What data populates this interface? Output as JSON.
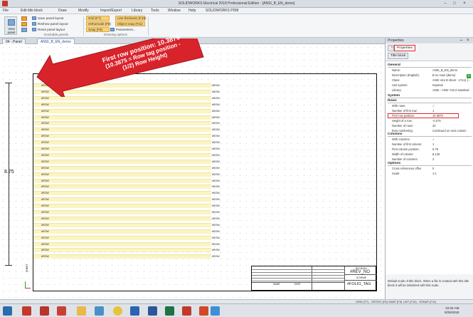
{
  "window": {
    "title": "SOLIDWORKS Electrical 2018 Professional Edition - [ANSI_B_EN_demo]"
  },
  "menu": [
    "File",
    "Edit title block",
    "Draw",
    "Modify",
    "Import/Export",
    "Library",
    "Tools",
    "Window",
    "Help",
    "SOLIDWORKS PDM"
  ],
  "ribbon": {
    "view_label": "View\npanel",
    "panel_buttons": [
      "Save panel layout",
      "Reshow panel layout",
      "Reset panel layout"
    ],
    "panel_group": "Dockable panels",
    "drawing_buttons": [
      "Grid (F7)",
      "Orthomode (F8)",
      "Snap (F9)",
      "Line thickness (F10)",
      "Object snap (F11)",
      "Parameters..."
    ],
    "drawing_group": "Drawing options"
  },
  "tabs": [
    "04 - Panel",
    "ANSI_B_EN_demo"
  ],
  "drawing": {
    "dimension": "8.75",
    "row_tag": "#ROW",
    "side_label": "SHEET",
    "title_block": {
      "rev_no": "#REV_NO",
      "folio_tag": "#FOLIO_TAG",
      "revision": "REVISION",
      "scheme": "SCHEME",
      "names": "NAME",
      "date": "DATE"
    }
  },
  "callout": {
    "line1": "First row position: 10.3875",
    "line2": "(10.3875 = Row tag position -",
    "line3": "(1/2) Row Height)"
  },
  "properties": {
    "header": "Properties",
    "tabs": [
      "Properties",
      "Title block"
    ],
    "sections": {
      "general": "General",
      "system": "System",
      "rows": "Rows",
      "columns": "Columns",
      "options": "Options"
    },
    "general": [
      {
        "k": "Name:",
        "v": "ANSI_B_EN_demo"
      },
      {
        "k": "Description (English):",
        "v": "B no rows (demo)"
      },
      {
        "k": "Class:",
        "v": "ANSI size B sheet - 17x11 (..."
      },
      {
        "k": "Unit system:",
        "v": "Imperial"
      },
      {
        "k": "Library:",
        "v": "ANSI - ANSI Y32.2 standard"
      }
    ],
    "rows": [
      {
        "k": "With rows:",
        "v": "✓"
      },
      {
        "k": "Number of first row:",
        "v": "1"
      },
      {
        "k": "First row position:",
        "v": "10.3875"
      },
      {
        "k": "Height of a row:",
        "v": "-0.275"
      },
      {
        "k": "Number of rows:",
        "v": "32"
      },
      {
        "k": "Row numbering:",
        "v": "Continued on next column"
      }
    ],
    "columns": [
      {
        "k": "With columns:",
        "v": "✓"
      },
      {
        "k": "Number of first column:",
        "v": "1"
      },
      {
        "k": "First column position:",
        "v": "0.75"
      },
      {
        "k": "Width of column:",
        "v": "8.125"
      },
      {
        "k": "Number of columns:",
        "v": "2"
      }
    ],
    "options": [
      {
        "k": "Cross references offse",
        "v": "0"
      },
      {
        "k": "Scale:",
        "v": "1:1"
      }
    ],
    "description": "Default scale of title block. When a file is created with this title block it will be initialized with this scale."
  },
  "statusbar": [
    "GRID (F7)",
    "ORTHO (F8)",
    "SNAP (F9)",
    "LWT (F10)",
    "OSNAP (F11)"
  ],
  "clock": {
    "time": "10:32 AM",
    "date": "9/25/2018"
  },
  "colors": {
    "accent": "#e0262c",
    "row_fill": "#fbf4c3",
    "ribbon_yellow": "#f7d27a"
  }
}
